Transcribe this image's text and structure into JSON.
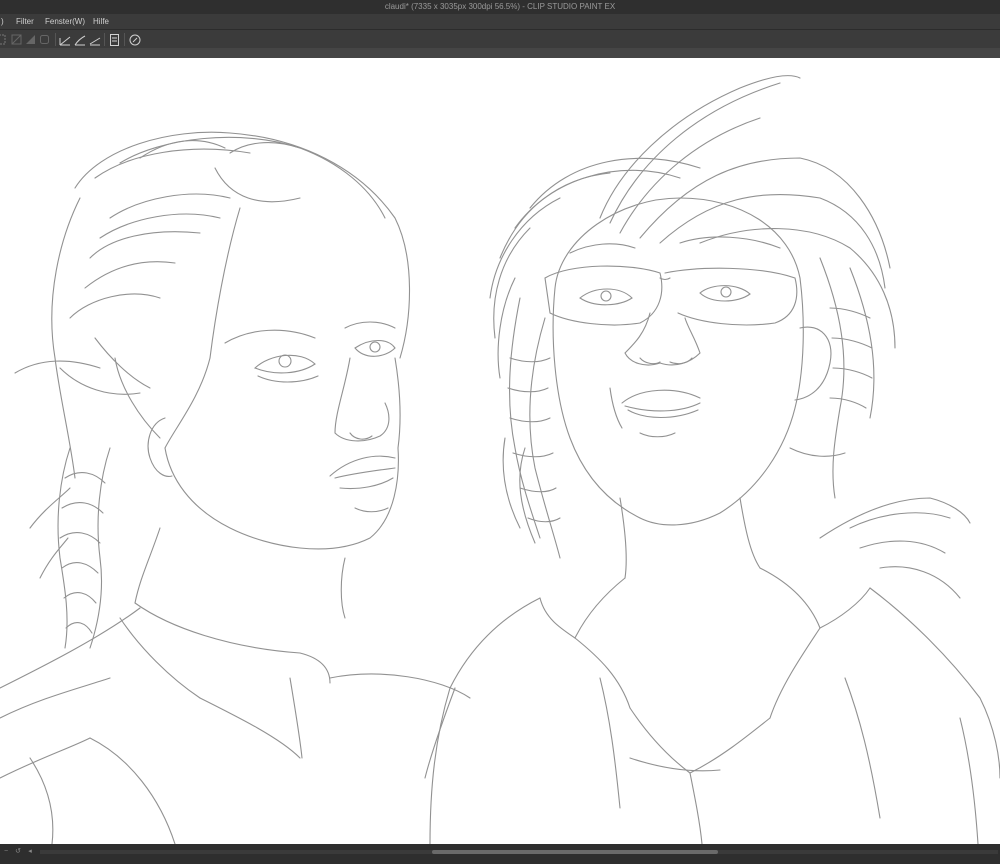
{
  "window": {
    "title": "claudi* (7335 x 3035px 300dpi 56.5%)  - CLIP STUDIO PAINT EX"
  },
  "menu": {
    "items": [
      {
        "label": ")"
      },
      {
        "label": "Filter"
      },
      {
        "label": "Fenster(W)"
      },
      {
        "label": "Hilfe"
      }
    ]
  },
  "toolbar": {
    "icons": [
      "partial-tool-icon",
      "clear-selection-icon",
      "fill-icon",
      "select-area-icon",
      "ruler-line-icon",
      "ruler-curve-icon",
      "ruler-straight-icon",
      "page-icon",
      "history-icon"
    ]
  },
  "status": {
    "buttons": [
      "zoom-out-icon",
      "rotate-icon",
      "navigator-icon"
    ]
  },
  "colors": {
    "titlebar": "#2f2f2f",
    "menubar": "#3b3b3b",
    "canvas": "#ffffff",
    "sketch_line": "#8c8c8c"
  }
}
